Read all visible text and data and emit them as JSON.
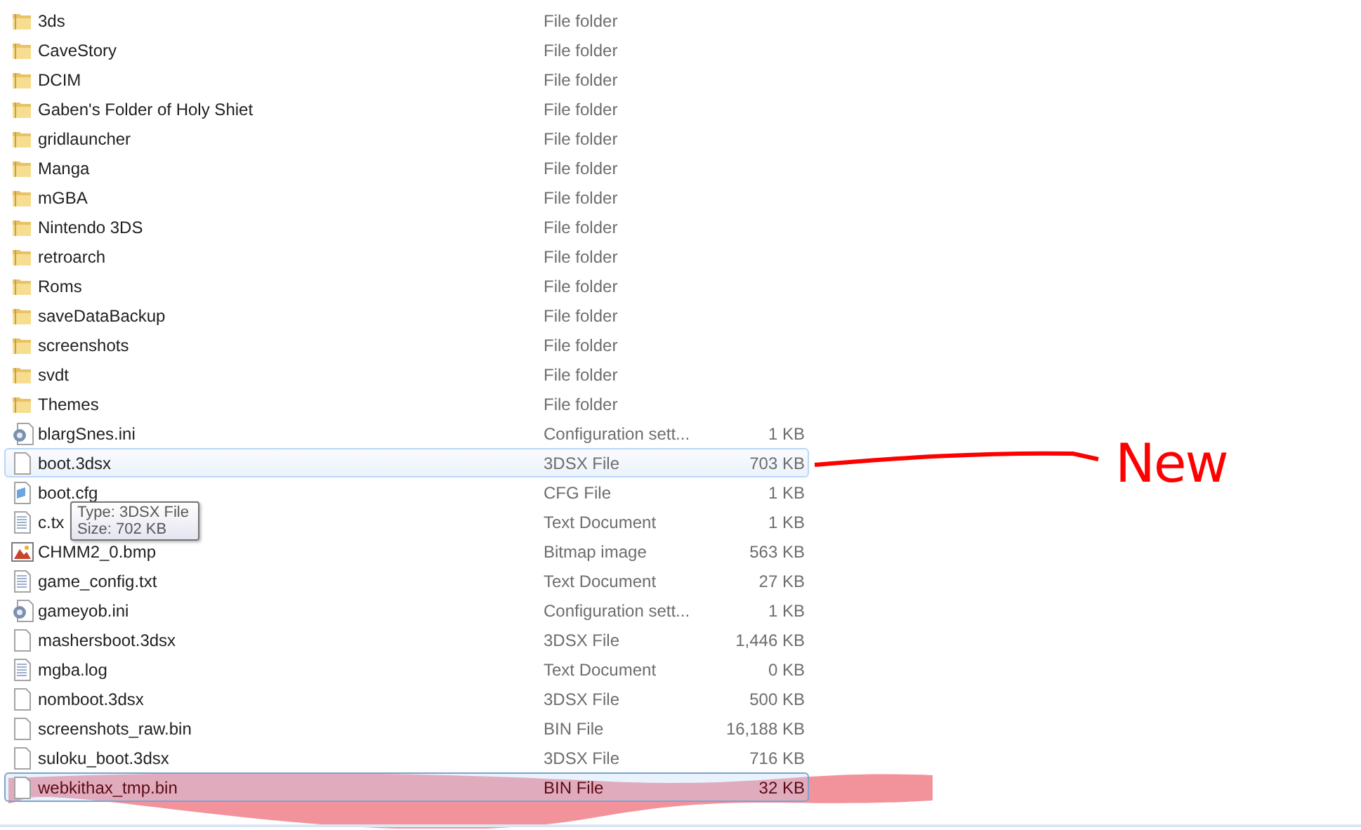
{
  "files": [
    {
      "kind": "folder",
      "name": "3ds",
      "type": "File folder",
      "selected": false,
      "hovered": false
    },
    {
      "kind": "folder",
      "name": "CaveStory",
      "type": "File folder",
      "selected": false,
      "hovered": false
    },
    {
      "kind": "folder",
      "name": "DCIM",
      "type": "File folder",
      "selected": false,
      "hovered": false
    },
    {
      "kind": "folder",
      "name": "Gaben's Folder of Holy Shiet",
      "type": "File folder",
      "selected": false,
      "hovered": false
    },
    {
      "kind": "folder",
      "name": "gridlauncher",
      "type": "File folder",
      "selected": false,
      "hovered": false
    },
    {
      "kind": "folder",
      "name": "Manga",
      "type": "File folder",
      "selected": false,
      "hovered": false
    },
    {
      "kind": "folder",
      "name": "mGBA",
      "type": "File folder",
      "selected": false,
      "hovered": false
    },
    {
      "kind": "folder",
      "name": "Nintendo 3DS",
      "type": "File folder",
      "selected": false,
      "hovered": false
    },
    {
      "kind": "folder",
      "name": "retroarch",
      "type": "File folder",
      "selected": false,
      "hovered": false
    },
    {
      "kind": "folder",
      "name": "Roms",
      "type": "File folder",
      "selected": false,
      "hovered": false
    },
    {
      "kind": "folder",
      "name": "saveDataBackup",
      "type": "File folder",
      "selected": false,
      "hovered": false
    },
    {
      "kind": "folder",
      "name": "screenshots",
      "type": "File folder",
      "selected": false,
      "hovered": false
    },
    {
      "kind": "folder",
      "name": "svdt",
      "type": "File folder",
      "selected": false,
      "hovered": false
    },
    {
      "kind": "folder",
      "name": "Themes",
      "type": "File folder",
      "selected": false,
      "hovered": false
    },
    {
      "kind": "settings",
      "name": "blargSnes.ini",
      "type": "Configuration sett...",
      "size": "1 KB",
      "selected": false,
      "hovered": false
    },
    {
      "kind": "blank",
      "name": "boot.3dsx",
      "type": "3DSX File",
      "size": "703 KB",
      "selected": false,
      "hovered": true
    },
    {
      "kind": "cfg",
      "name": "boot.cfg",
      "type": "CFG File",
      "size": "1 KB",
      "selected": false,
      "hovered": false
    },
    {
      "kind": "text",
      "name": "c.tx",
      "type": "Text Document",
      "size": "1 KB",
      "selected": false,
      "hovered": false
    },
    {
      "kind": "bitmap",
      "name": "CHMM2_0.bmp",
      "type": "Bitmap image",
      "size": "563 KB",
      "selected": false,
      "hovered": false
    },
    {
      "kind": "text",
      "name": "game_config.txt",
      "type": "Text Document",
      "size": "27 KB",
      "selected": false,
      "hovered": false
    },
    {
      "kind": "settings",
      "name": "gameyob.ini",
      "type": "Configuration sett...",
      "size": "1 KB",
      "selected": false,
      "hovered": false
    },
    {
      "kind": "blank",
      "name": "mashersboot.3dsx",
      "type": "3DSX File",
      "size": "1,446 KB",
      "selected": false,
      "hovered": false
    },
    {
      "kind": "text",
      "name": "mgba.log",
      "type": "Text Document",
      "size": "0 KB",
      "selected": false,
      "hovered": false
    },
    {
      "kind": "blank",
      "name": "nomboot.3dsx",
      "type": "3DSX File",
      "size": "500 KB",
      "selected": false,
      "hovered": false
    },
    {
      "kind": "blank",
      "name": "screenshots_raw.bin",
      "type": "BIN File",
      "size": "16,188 KB",
      "selected": false,
      "hovered": false
    },
    {
      "kind": "blank",
      "name": "suloku_boot.3dsx",
      "type": "3DSX File",
      "size": "716 KB",
      "selected": false,
      "hovered": false
    },
    {
      "kind": "blank",
      "name": "webkithax_tmp.bin",
      "type": "BIN File",
      "size": "32 KB",
      "selected": true,
      "hovered": false
    }
  ],
  "tooltip": {
    "lines": [
      "Type: 3DSX File",
      "Size: 702 KB"
    ]
  },
  "annotation": {
    "label": "New"
  }
}
